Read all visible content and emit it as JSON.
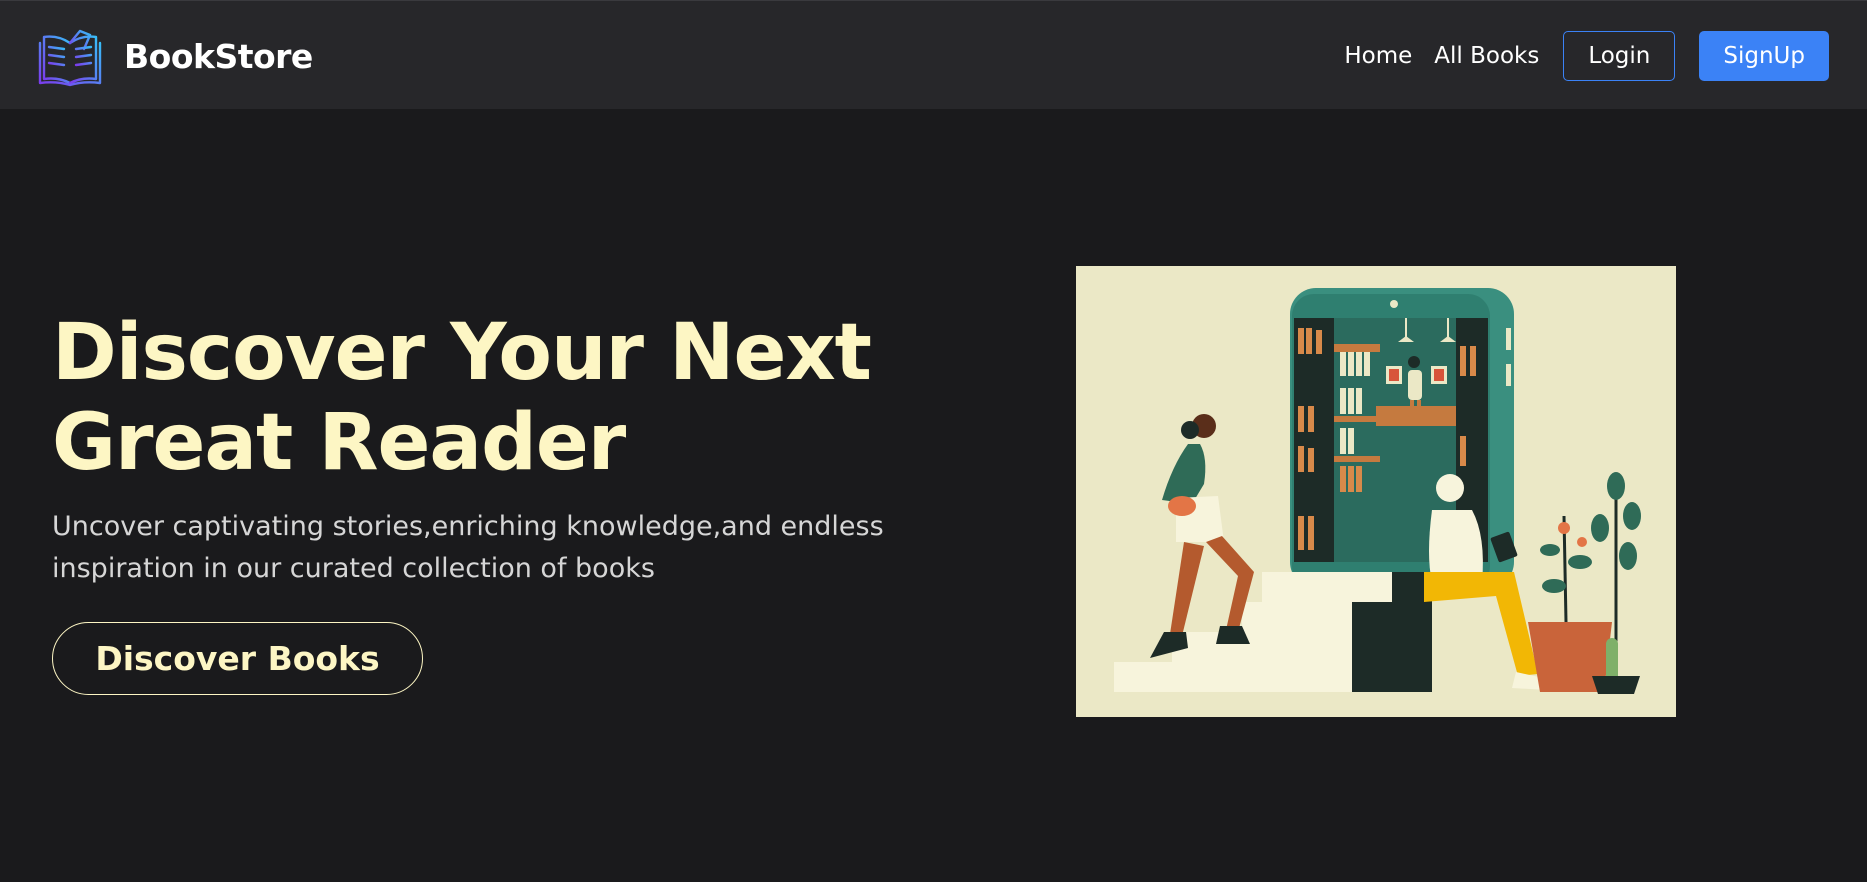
{
  "nav": {
    "brand": "BookStore",
    "links": [
      "Home",
      "All Books"
    ],
    "login_label": "Login",
    "signup_label": "SignUp"
  },
  "hero": {
    "title_line1": "Discover Your Next",
    "title_line2": "Great Reader",
    "subtitle": "Uncover captivating stories,enriching knowledge,and endless inspiration in our curated collection of books",
    "cta_label": "Discover Books"
  },
  "icons": {
    "logo": "open-book-icon"
  },
  "colors": {
    "background": "#1a1a1c",
    "navbar": "#27272a",
    "accent_blue": "#3b82f6",
    "hero_text": "#fdf6c4",
    "illustration_bg": "#ebe8c6"
  }
}
